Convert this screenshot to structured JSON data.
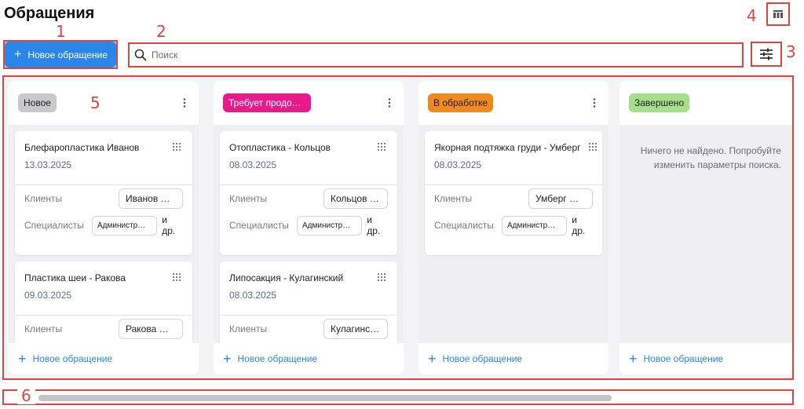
{
  "header": {
    "title": "Обращения",
    "view_toggle_icon": "kanban-view-icon",
    "new_button_label": "Новое обращение",
    "search_placeholder": "Поиск",
    "filter_icon": "filter-sliders-icon"
  },
  "annotations": [
    "1",
    "2",
    "3",
    "4",
    "5",
    "6"
  ],
  "labels": {
    "clients": "Клиенты",
    "specialists": "Специалисты",
    "and_more": "и др.",
    "add_request": "Новое обращение"
  },
  "columns": [
    {
      "name": "Новое",
      "color": "#c9c9cc",
      "text_color": "#1f1f1f",
      "cards": [
        {
          "title": "Блефаропластика Иванов",
          "date": "13.03.2025",
          "client": "Иванов …",
          "specialist": "Администр…"
        },
        {
          "title": "Пластика шеи - Ракова",
          "date": "09.03.2025",
          "client": "Ракова …"
        }
      ]
    },
    {
      "name": "Требует продол…",
      "color": "#e8198b",
      "text_color": "#ffffff",
      "cards": [
        {
          "title": "Отопластика - Кольцов",
          "date": "08.03.2025",
          "client": "Кольцов …",
          "specialist": "Администр…"
        },
        {
          "title": "Липосакция - Кулагинский",
          "date": "08.03.2025",
          "client": "Кулагинс…"
        }
      ]
    },
    {
      "name": "В обработке",
      "color": "#f08a1c",
      "text_color": "#1f1f1f",
      "cards": [
        {
          "title": "Якорная подтяжка груди - Умберг",
          "date": "08.03.2025",
          "client": "Умберг …",
          "specialist": "Администр…"
        }
      ]
    },
    {
      "name": "Завершено",
      "color": "#a6de8c",
      "text_color": "#1f1f1f",
      "empty_text": "Ничего не найдено. Попробуйте изменить параметры поиска."
    }
  ]
}
